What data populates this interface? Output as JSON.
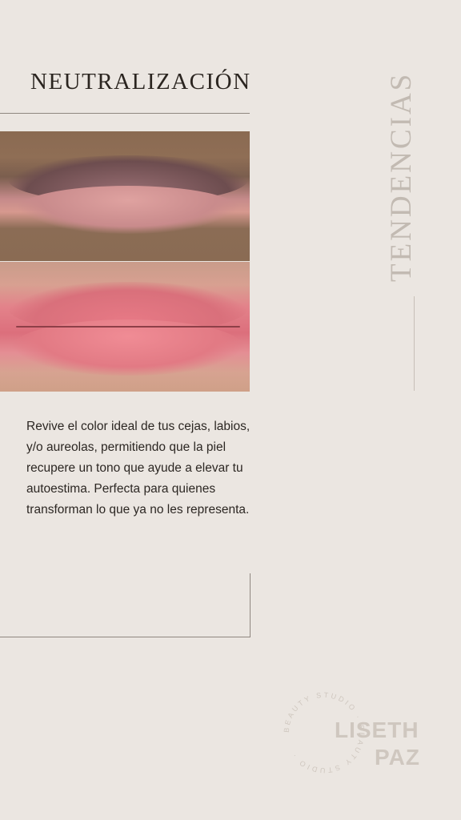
{
  "header": {
    "title": "NEUTRALIZACIÓN"
  },
  "side": {
    "vertical_label": "TENDENCIAS"
  },
  "photos": {
    "before": "lips-before",
    "after": "lips-after"
  },
  "body": {
    "description": "Revive el color ideal de tus cejas, labios, y/o aureolas, permitiendo que la piel recupere un tono que ayude a elevar tu autoestima. Perfecta para quienes transforman lo que ya no les representa."
  },
  "logo": {
    "name_line1": "LISETH",
    "name_line2": "PAZ",
    "ring_text": "BEAUTY STUDIO · BEAUTY STUDIO ·"
  },
  "colors": {
    "background": "#ebe6e1",
    "accent_text": "#c2bab2",
    "logo": "#cfc7bf"
  }
}
